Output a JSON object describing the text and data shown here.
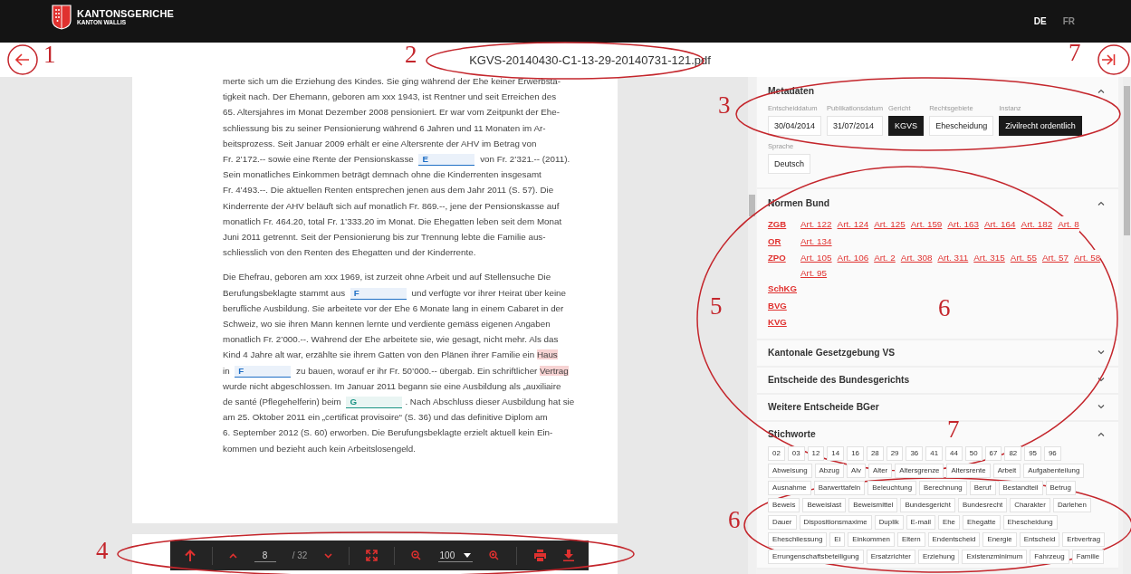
{
  "header": {
    "logo_title": "KANTONSGERICHE",
    "logo_subtitle": "KANTON WALLIS",
    "languages": [
      {
        "label": "DE",
        "selected": true
      },
      {
        "label": "FR",
        "selected": false
      }
    ]
  },
  "title_bar": {
    "filename": "KGVS-20140430-C1-13-29-20140731-121.pdf"
  },
  "document": {
    "paragraphs": [
      [
        {
          "kind": "text",
          "text": "merte sich um die Erziehung des Kindes. Sie ging während der Ehe keiner Erwerbsta-\ntigkeit nach. Der Ehemann, geboren am xxx 1943, ist Rentner und seit Erreichen des\n65. Altersjahres im Monat Dezember 2008 pensioniert. Er war vom Zeitpunkt der Ehe-\nschliessung bis zu seiner Pensionierung während 6 Jahren und 11 Monaten im Ar-\nbeitsprozess. Seit Januar 2009 erhält er eine Altersrente der AHV im Betrag von\nFr. 2’172.-- sowie eine Rente der Pensionskasse "
        },
        {
          "kind": "redaction",
          "text": "E",
          "color": "#1f6fc5"
        },
        {
          "kind": "text",
          "text": " von Fr. 2’321.-- (2011).\nSein monatliches Einkommen beträgt demnach ohne die Kinderrenten insgesamt\nFr. 4’493.--. Die aktuellen Renten entsprechen jenen aus dem Jahr 2011 (S. 57). Die\nKinderrente der AHV beläuft sich auf monatlich Fr. 869.--, jene der Pensionskasse auf\nmonatlich Fr. 464.20, total Fr. 1’333.20 im Monat. Die Ehegatten leben seit dem Monat\nJuni 2011 getrennt. Seit der Pensionierung bis zur Trennung lebte die Familie aus-\nschliesslich von den Renten des Ehegatten und der Kinderrente."
        }
      ],
      [
        {
          "kind": "text",
          "text": "Die Ehefrau, geboren am xxx 1969, ist zurzeit ohne Arbeit und auf Stellensuche Die\nBerufungsbeklagte stammt aus "
        },
        {
          "kind": "redaction",
          "text": "F",
          "color": "#1f6fc5"
        },
        {
          "kind": "text",
          "text": " und verfügte vor ihrer Heirat über keine\nberufliche Ausbildung. Sie arbeitete vor der Ehe 6 Monate lang in einem Cabaret in der\nSchweiz, wo sie ihren Mann kennen lernte und verdiente gemäss eigenen Angaben\nmonatlich Fr. 2’000.--. Während der Ehe arbeitete sie, wie gesagt, nicht mehr. Als das\nKind 4 Jahre alt war, erzählte sie ihrem Gatten von den Plänen ihrer Familie ein "
        },
        {
          "kind": "highlight",
          "text": "Haus"
        },
        {
          "kind": "text",
          "text": "\nin "
        },
        {
          "kind": "redaction",
          "text": "F",
          "color": "#1f6fc5"
        },
        {
          "kind": "text",
          "text": " zu bauen, worauf er ihr Fr. 50’000.-- übergab. Ein schriftlicher "
        },
        {
          "kind": "highlight",
          "text": "Vertrag"
        },
        {
          "kind": "text",
          "text": "\nwurde nicht abgeschlossen. Im Januar 2011 begann sie eine Ausbildung als „auxiliaire\nde santé (Pflegehelferin) beim "
        },
        {
          "kind": "redaction",
          "text": "G",
          "color": "#1a9484"
        },
        {
          "kind": "text",
          "text": ". Nach Abschluss dieser Ausbildung hat sie\nam 25. Oktober 2011 ein „certificat provisoire“ (S. 36) und das definitive Diplom am\n6. September 2012 (S. 60) erworben. Die Berufungsbeklagte erzielt aktuell kein Ein-\nkommen und bezieht auch kein Arbeitslosengeld."
        }
      ]
    ]
  },
  "toolbar": {
    "page": "8",
    "total": "/ 32",
    "zoom": "100"
  },
  "sidebar": {
    "sections": [
      {
        "title": "Metadaten",
        "kind": "metadata",
        "expanded": true,
        "rows": [
          [
            {
              "label": "Entscheiddatum",
              "value": "30/04/2014",
              "filled": false
            },
            {
              "label": "Publikationsdatum",
              "value": "31/07/2014",
              "filled": false
            },
            {
              "label": "Gericht",
              "value": "KGVS",
              "filled": true
            },
            {
              "label": "Rechtsgebiete",
              "value": "Ehescheidung",
              "filled": false
            },
            {
              "label": "Instanz",
              "value": "Zivilrecht ordentlich",
              "filled": true
            }
          ],
          [
            {
              "label": "Sprache",
              "value": "Deutsch",
              "filled": false
            }
          ]
        ]
      },
      {
        "title": "Normen Bund",
        "kind": "norms",
        "expanded": true,
        "laws": [
          {
            "law": "ZGB",
            "articles": [
              "Art. 122",
              "Art. 124",
              "Art. 125",
              "Art. 159",
              "Art. 163",
              "Art. 164",
              "Art. 182",
              "Art. 8"
            ]
          },
          {
            "law": "OR",
            "articles": [
              "Art. 134"
            ]
          },
          {
            "law": "ZPO",
            "articles": [
              "Art. 105",
              "Art. 106",
              "Art. 2",
              "Art. 308",
              "Art. 311",
              "Art. 315",
              "Art. 55",
              "Art. 57",
              "Art. 58",
              "Art. 95"
            ]
          },
          {
            "law": "SchKG"
          },
          {
            "law": "BVG"
          },
          {
            "law": "KVG"
          }
        ]
      },
      {
        "title": "Kantonale Gesetzgebung VS",
        "kind": "plain",
        "expanded": false
      },
      {
        "title": "Entscheide des Bundesgerichts",
        "kind": "plain",
        "expanded": false
      },
      {
        "title": "Weitere Entscheide BGer",
        "kind": "plain",
        "expanded": false
      },
      {
        "title": "Stichworte",
        "kind": "tags",
        "expanded": true,
        "tags": [
          "02",
          "03",
          "12",
          "14",
          "16",
          "28",
          "29",
          "36",
          "41",
          "44",
          "50",
          "67",
          "82",
          "95",
          "96",
          "Abweisung",
          "Abzug",
          "Alv",
          "Alter",
          "Altersgrenze",
          "Altersrente",
          "Arbeit",
          "Aufgabenteilung",
          "Ausnahme",
          "Barwerttafeln",
          "Beleuchtung",
          "Berechnung",
          "Beruf",
          "Bestandteil",
          "Betrug",
          "Beweis",
          "Beweislast",
          "Beweismittel",
          "Bundesgericht",
          "Bundesrecht",
          "Charakter",
          "Darlehen",
          "Dauer",
          "Dispositionsmaxime",
          "Duplik",
          "E-mail",
          "Ehe",
          "Ehegatte",
          "Ehescheidung",
          "Eheschliessung",
          "Ei",
          "Einkommen",
          "Eltern",
          "Endentscheid",
          "Energie",
          "Entscheid",
          "Erbvertrag",
          "Errungenschaftsbeteiligung",
          "Ersatzrichter",
          "Erziehung",
          "Existenzminimum",
          "Fahrzeug",
          "Familie"
        ]
      }
    ]
  },
  "annotations": [
    {
      "label": "1"
    },
    {
      "label": "2"
    },
    {
      "label": "7"
    },
    {
      "label": "3"
    },
    {
      "label": "5"
    },
    {
      "label": "6"
    },
    {
      "label": "7"
    },
    {
      "label": "6"
    },
    {
      "label": "4"
    }
  ]
}
